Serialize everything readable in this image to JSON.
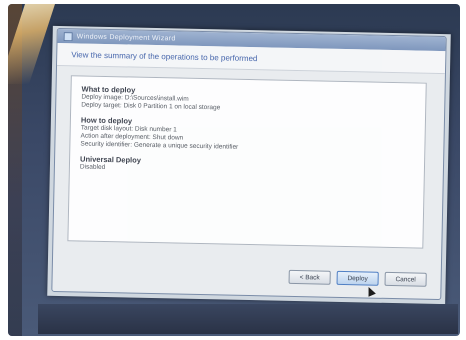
{
  "window": {
    "title": "Windows Deployment Wizard"
  },
  "header": {
    "instruction": "View the summary of the operations to be performed"
  },
  "summary": {
    "sections": [
      {
        "heading": "What to deploy",
        "lines": [
          "Deploy image: D:\\Sources\\install.wim",
          "Deploy target: Disk 0 Partition 1 on local storage"
        ]
      },
      {
        "heading": "How to deploy",
        "lines": [
          "Target disk layout: Disk number 1",
          "Action after deployment: Shut down",
          "Security identifier: Generate a unique security identifier"
        ]
      },
      {
        "heading": "Universal Deploy",
        "lines": [
          "Disabled"
        ]
      }
    ]
  },
  "buttons": {
    "back_label": "< Back",
    "deploy_label": "Deploy",
    "cancel_label": "Cancel"
  }
}
